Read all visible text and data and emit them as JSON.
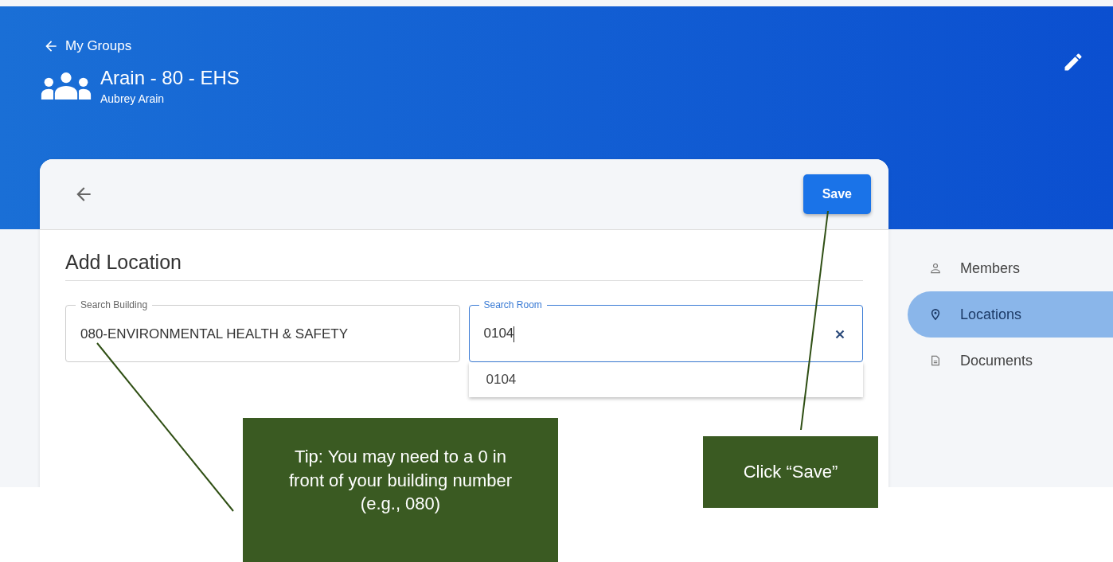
{
  "header": {
    "back_link": "My Groups",
    "group_name": "Arain - 80 - EHS",
    "owner": "Aubrey Arain"
  },
  "card": {
    "save_button": "Save",
    "title": "Add Location",
    "fields": [
      {
        "label": "Search Building",
        "value": "080-ENVIRONMENTAL HEALTH & SAFETY",
        "focused": false
      },
      {
        "label": "Search Room",
        "value": "0104",
        "focused": true
      }
    ],
    "suggestions": [
      "0104"
    ]
  },
  "sidebar": {
    "items": [
      {
        "label": "Members",
        "kind": "person",
        "selected": false
      },
      {
        "label": "Locations",
        "kind": "pin",
        "selected": true
      },
      {
        "label": "Documents",
        "kind": "document",
        "selected": false
      }
    ]
  },
  "callouts": [
    {
      "text": "Tip: You may need to a 0 in front of your building number (e.g., 080)"
    },
    {
      "text": "Click “Save”"
    }
  ]
}
